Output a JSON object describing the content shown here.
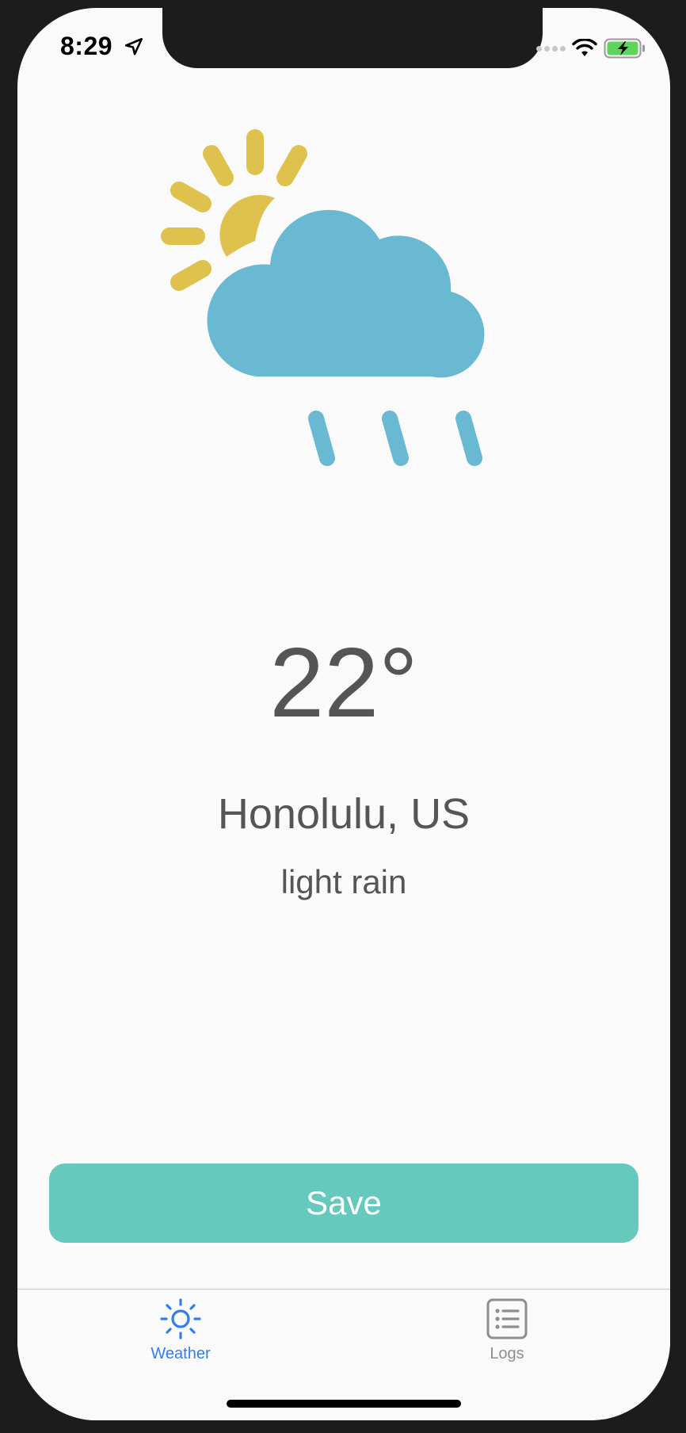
{
  "status_bar": {
    "time": "8:29",
    "location_icon": "location-arrow-icon",
    "signal_icon": "signal-dots-icon",
    "wifi_icon": "wifi-icon",
    "battery_icon": "battery-charging-icon"
  },
  "weather": {
    "icon": "partly-cloudy-rain-icon",
    "temperature": "22°",
    "location": "Honolulu, US",
    "description": "light rain"
  },
  "actions": {
    "save_label": "Save"
  },
  "tabbar": {
    "tabs": [
      {
        "label": "Weather",
        "icon": "sun-icon",
        "active": true
      },
      {
        "label": "Logs",
        "icon": "list-icon",
        "active": false
      }
    ]
  },
  "colors": {
    "sun": "#dfc24e",
    "cloud": "#69b9d3",
    "save_button": "#66c9bd",
    "active_tab": "#2f7ff0",
    "inactive_tab": "#8e8e8e",
    "text": "#555555"
  }
}
